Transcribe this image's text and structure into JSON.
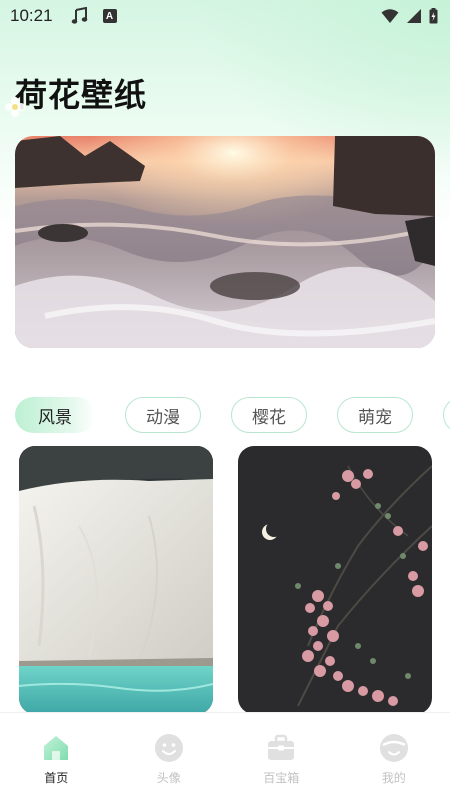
{
  "status_bar": {
    "time": "10:21",
    "left_icons": [
      "music-note-icon",
      "a-notification-icon"
    ],
    "right_icons": [
      "wifi-icon",
      "signal-icon",
      "battery-icon"
    ],
    "a_letter": "A"
  },
  "header": {
    "title": "荷花壁纸"
  },
  "banner": {
    "image": "ocean-waves-sunset"
  },
  "categories": {
    "tabs": [
      {
        "label": "风景",
        "active": true
      },
      {
        "label": "动漫",
        "active": false
      },
      {
        "label": "樱花",
        "active": false
      },
      {
        "label": "萌宠",
        "active": false
      }
    ]
  },
  "wallpapers": [
    {
      "image": "white-cliff-turquoise-sea"
    },
    {
      "image": "pink-blossoms-night-moon"
    }
  ],
  "bottom_nav": {
    "items": [
      {
        "label": "首页",
        "icon": "home-icon",
        "active": true
      },
      {
        "label": "头像",
        "icon": "smiley-face-icon",
        "active": false
      },
      {
        "label": "百宝箱",
        "icon": "toolbox-icon",
        "active": false
      },
      {
        "label": "我的",
        "icon": "profile-face-icon",
        "active": false
      }
    ]
  },
  "colors": {
    "accent": "#9fe8c1",
    "inactive": "#d8d8d8",
    "tab_border": "#b9e6cf"
  }
}
